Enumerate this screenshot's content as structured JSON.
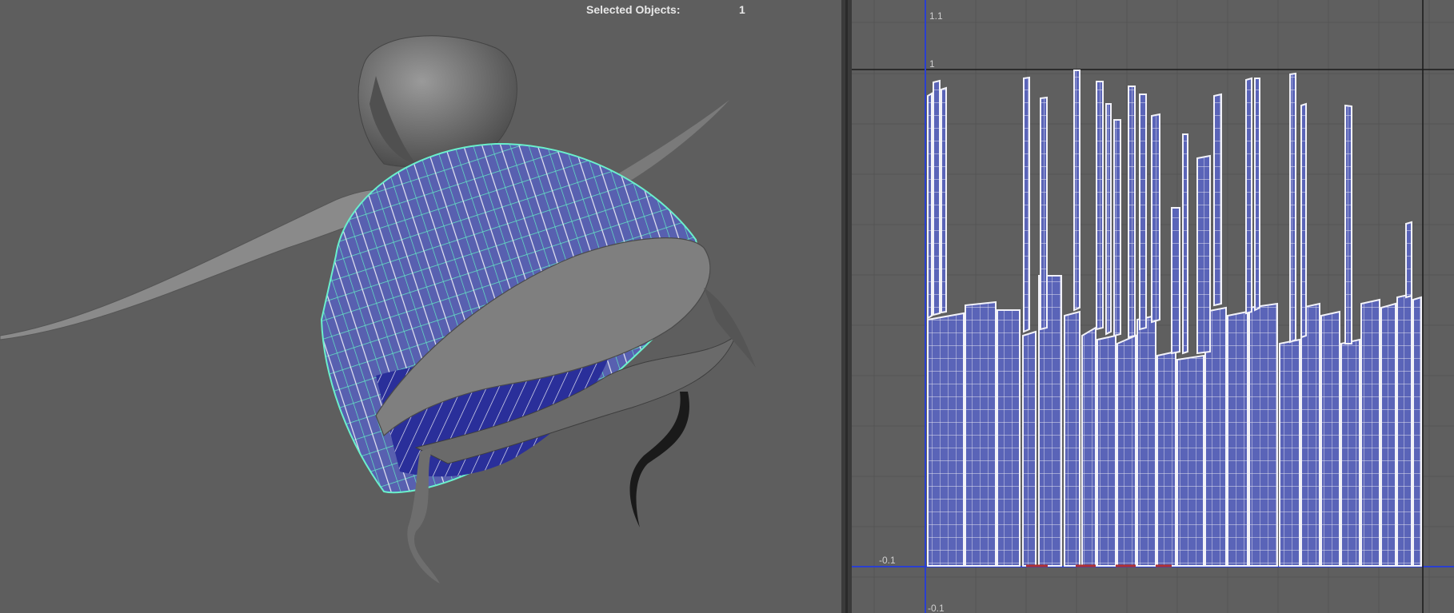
{
  "hud": {
    "selected_label": "Selected Objects:",
    "selected_count": "1"
  },
  "uv_editor": {
    "axis_labels": {
      "top": "1.1",
      "one": "1",
      "neg_left": "-0.1",
      "neg_bottom": "-0.1"
    }
  },
  "colors": {
    "viewport_bg": "#5e5e5e",
    "uv_shell_fill": "#5a64b8",
    "uv_wire": "#e6e6f2",
    "selection_wire": "#5cf0c8",
    "axis_blue": "#2a3fd0"
  }
}
